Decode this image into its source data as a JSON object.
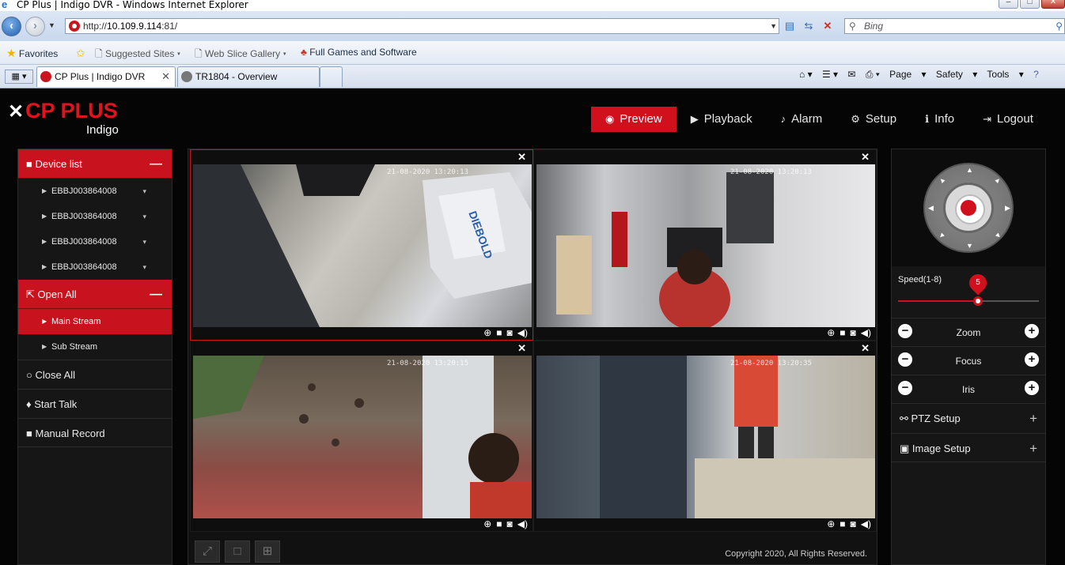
{
  "browser": {
    "window_title": "CP Plus | Indigo DVR - Windows Internet Explorer",
    "address_prefix": "http://",
    "address_host": "10.109.9.114",
    "address_port": ":81/",
    "search_placeholder": "Bing",
    "favorites": {
      "label": "Favorites",
      "items": [
        "Suggested Sites",
        "Web Slice Gallery",
        "Full Games and Software"
      ]
    },
    "tabs": [
      {
        "label": "CP Plus | Indigo DVR",
        "active": true
      },
      {
        "label": "TR1804 - Overview",
        "active": false
      }
    ],
    "command_bar": [
      "Page",
      "Safety",
      "Tools"
    ]
  },
  "app": {
    "brand": "CP PLUS",
    "brand_sub": "Indigo",
    "nav": [
      {
        "label": "Preview",
        "icon": "eye-icon",
        "active": true
      },
      {
        "label": "Playback",
        "icon": "play-icon",
        "active": false
      },
      {
        "label": "Alarm",
        "icon": "bell-icon",
        "active": false
      },
      {
        "label": "Setup",
        "icon": "gear-icon",
        "active": false
      },
      {
        "label": "Info",
        "icon": "info-icon",
        "active": false
      },
      {
        "label": "Logout",
        "icon": "logout-icon",
        "active": false
      }
    ],
    "sidebar": {
      "device_list_label": "Device list",
      "devices": [
        "EBBJ003864008",
        "EBBJ003864008",
        "EBBJ003864008",
        "EBBJ003864008"
      ],
      "open_all_label": "Open All",
      "streams": [
        {
          "label": "Main Stream",
          "selected": true
        },
        {
          "label": "Sub Stream",
          "selected": false
        }
      ],
      "close_all_label": "Close All",
      "start_talk_label": "Start Talk",
      "manual_record_label": "Manual Record"
    },
    "video": {
      "cells": [
        {
          "timestamp": "21-08-2020  13:20:13"
        },
        {
          "timestamp": "21-08-2020  13:20:13"
        },
        {
          "timestamp": "21-08-2020  13:20:15"
        },
        {
          "timestamp": "21-08-2020 13:20:35"
        }
      ],
      "copyright": "Copyright 2020, All Rights Reserved."
    },
    "ptz": {
      "speed_label": "Speed(1-8)",
      "speed_value": "5",
      "speed_fraction": 0.57,
      "rows": [
        "Zoom",
        "Focus",
        "Iris"
      ],
      "sections": [
        {
          "label": "PTZ Setup",
          "icon": "gamepad-icon"
        },
        {
          "label": "Image Setup",
          "icon": "image-icon"
        }
      ]
    },
    "colors": {
      "accent": "#d0101d",
      "background": "#050505"
    }
  }
}
